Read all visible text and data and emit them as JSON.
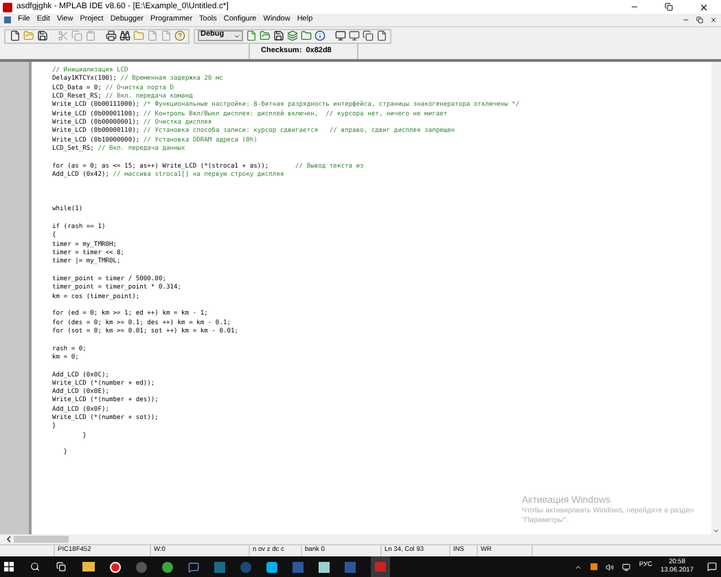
{
  "window": {
    "title": "asdfgjghk - MPLAB IDE v8.60 - [E:\\Example_0\\Untitled.c*]"
  },
  "menu": [
    "File",
    "Edit",
    "View",
    "Project",
    "Debugger",
    "Programmer",
    "Tools",
    "Configure",
    "Window",
    "Help"
  ],
  "toolbar": {
    "config": "Debug",
    "checksum": "Checksum:  0x82d8"
  },
  "code": [
    {
      "comment": "// Инициализация LCD"
    },
    {
      "code": "Delay1KTCYx(100); ",
      "comment": "// Временная задержка 20 мс"
    },
    {
      "code": "LCD_Data = 0; ",
      "comment": "// Очистка порта D"
    },
    {
      "code": "LCD_Reset_RS; ",
      "comment": "// Вкл. передача команд"
    },
    {
      "code": "Write_LCD (0b00111000); ",
      "comment": "/* Функциональные настройки: 8-битная разрядность интерфейса, страницы знакогенератора отключены */"
    },
    {
      "code": "Write_LCD (0b00001100); ",
      "comment": "// Контроль Вкл/Выкл дисплея: дисплей включен,  // курсора нет, ничего не мигает"
    },
    {
      "code": "Write_LCD (0b00000001); ",
      "comment": "// Очистка дисплея"
    },
    {
      "code": "Write_LCD (0b00000110); ",
      "comment": "// Установка способа записи: курсор сдвигается   // вправо, сдвиг дисплея запрещен"
    },
    {
      "code": "Write_LCD (0b10000000); ",
      "comment": "// Установка DDRAM адреса (0h)"
    },
    {
      "code": "LCD_Set_RS; ",
      "comment": "// Вкл. передача данных"
    },
    {
      "blank_before": true,
      "code": "for (as = 0; as <= 15; as++) Write_LCD (*(stroca1 + as));       ",
      "comment": "// Вывод текста из"
    },
    {
      "code": "Add_LCD (0x42); ",
      "comment": "// массива stroca1[] на первую строку дисплея"
    },
    {
      "blank_before": true,
      "wide_gap_before": true,
      "code": "while(1)"
    },
    {
      "blank_before": true,
      "code": "if (rash == 1)"
    },
    {
      "code": "{"
    },
    {
      "code": "timer = my_TMR0H;"
    },
    {
      "code": "timer = timer << 8;"
    },
    {
      "code": "timer |= my_TMR0L;"
    },
    {
      "blank_before": true,
      "code": "timer_point = timer / 5000.00;"
    },
    {
      "code": "timer_point = timer_point * 0.314;"
    },
    {
      "code": "km = cos (timer_point);"
    },
    {
      "blank_before": true,
      "code": "for (ed = 0; km >= 1; ed ++) km = km - 1;"
    },
    {
      "code": "for (des = 0; km >= 0.1; des ++) km = km - 0.1;"
    },
    {
      "code": "for (sot = 0; km >= 0.01; sot ++) km = km - 0.01;"
    },
    {
      "blank_before": true,
      "code": "rash = 0;"
    },
    {
      "code": "km = 0;"
    },
    {
      "blank_before": true,
      "code": "Add_LCD (0x0C);"
    },
    {
      "code": "Write_LCD (*(number + ed));"
    },
    {
      "code": "Add_LCD (0x0E);"
    },
    {
      "code": "Write_LCD (*(number + des));"
    },
    {
      "code": "Add_LCD (0x0F);"
    },
    {
      "code": "Write_LCD (*(number + sot));"
    },
    {
      "code": "}"
    },
    {
      "code": "        }"
    },
    {
      "blank_before": true,
      "code": "   }"
    }
  ],
  "activation": {
    "title": "Активация Windows",
    "text": "Чтобы активировать Windows, перейдите в раздел \"Параметры\"."
  },
  "status_bar": [
    "PIC18F452",
    "W:0",
    "n ov z dc c",
    "bank 0",
    "Ln 34, Col 93",
    "INS",
    "WR"
  ],
  "taskbar": {
    "language": "РУС",
    "time": "20:58",
    "date": "13.06.2017"
  }
}
